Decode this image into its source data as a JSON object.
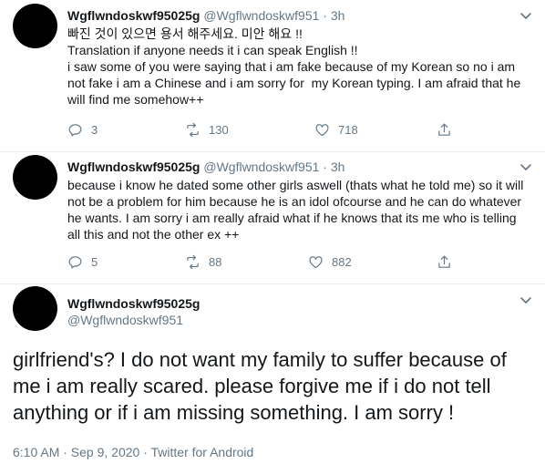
{
  "tweets": [
    {
      "name": "Wgflwndoskwf95025g",
      "handle": "@Wgflwndoskwf951",
      "separator": "·",
      "time": "3h",
      "text": "빠진 것이 있으면 용서 해주세요. 미안 해요 !!\nTranslation if anyone needs it i can speak English !!\ni saw some of you were saying that i am fake because of my Korean so no i am not fake i am a Chinese and i am sorry for  my Korean typing. I am afraid that he will find me somehow++",
      "replies": "3",
      "retweets": "130",
      "likes": "718"
    },
    {
      "name": "Wgflwndoskwf95025g",
      "handle": "@Wgflwndoskwf951",
      "separator": "·",
      "time": "3h",
      "text": "because i know he dated some other girls aswell (thats what he told me) so it will not be a problem for him because he is an idol ofcourse and he can do whatever he wants. I am sorry i am really afraid what if he knows that its me who is telling all this and not the other ex ++",
      "replies": "5",
      "retweets": "88",
      "likes": "882"
    }
  ],
  "main_tweet": {
    "name": "Wgflwndoskwf95025g",
    "handle": "@Wgflwndoskwf951",
    "text": "girlfriend's? I do not want my family to suffer because of me i am really scared. please forgive me if i do not tell anything or if i am missing something. I am sorry !",
    "timestamp": "6:10 AM · Sep 9, 2020 · Twitter for Android"
  },
  "icons": {
    "reply": "reply-icon",
    "retweet": "retweet-icon",
    "like": "heart-icon",
    "share": "share-icon",
    "more": "chevron-down-icon"
  },
  "colors": {
    "secondary_text": "#657786",
    "icon": "#657786",
    "divider": "#e6ecf0"
  }
}
